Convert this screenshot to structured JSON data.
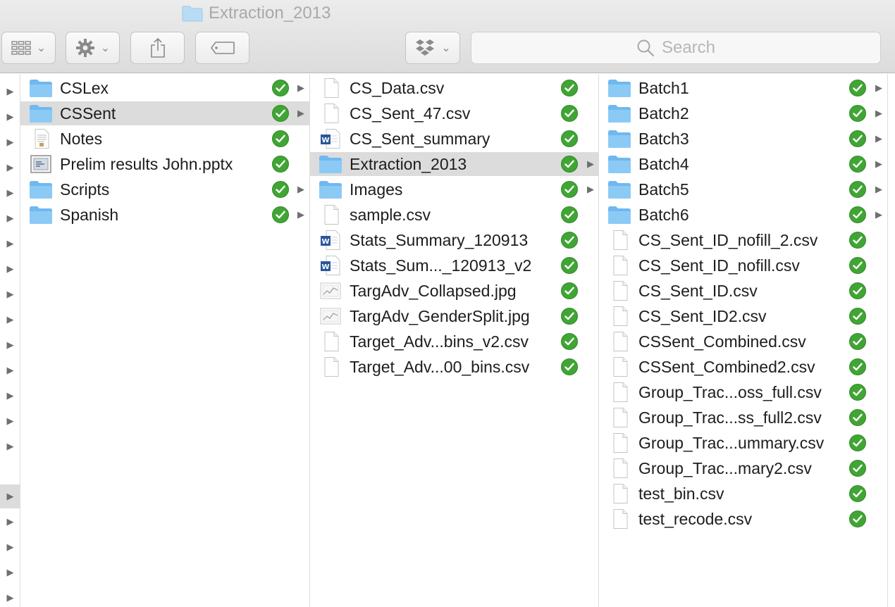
{
  "window": {
    "title": "Extraction_2013"
  },
  "toolbar": {
    "view_icon": "icon-grid-view",
    "action_icon": "gear-icon",
    "share_icon": "share-icon",
    "tag_icon": "tag-icon",
    "dropbox_icon": "dropbox-icon",
    "search_placeholder": "Search"
  },
  "colors": {
    "selection": "#dcdcdc",
    "folder": "#6fb8f0",
    "sync_check": "#41a535",
    "title_text": "#a9a9a9"
  },
  "column1": {
    "items": [
      {
        "name": "CSLex",
        "type": "folder",
        "expandable": true,
        "selected": false
      },
      {
        "name": "CSSent",
        "type": "folder",
        "expandable": true,
        "selected": true
      },
      {
        "name": "Notes",
        "type": "text-doc",
        "expandable": false,
        "selected": false
      },
      {
        "name": "Prelim results John.pptx",
        "type": "pptx",
        "expandable": false,
        "selected": false
      },
      {
        "name": "Scripts",
        "type": "folder",
        "expandable": true,
        "selected": false
      },
      {
        "name": "Spanish",
        "type": "folder",
        "expandable": true,
        "selected": false
      }
    ]
  },
  "column2": {
    "items": [
      {
        "name": "CS_Data.csv",
        "type": "file",
        "expandable": false,
        "selected": false
      },
      {
        "name": "CS_Sent_47.csv",
        "type": "file",
        "expandable": false,
        "selected": false
      },
      {
        "name": "CS_Sent_summary",
        "type": "word",
        "expandable": false,
        "selected": false
      },
      {
        "name": "Extraction_2013",
        "type": "folder",
        "expandable": true,
        "selected": true
      },
      {
        "name": "Images",
        "type": "folder",
        "expandable": true,
        "selected": false
      },
      {
        "name": "sample.csv",
        "type": "file",
        "expandable": false,
        "selected": false
      },
      {
        "name": "Stats_Summary_120913",
        "type": "word",
        "expandable": false,
        "selected": false
      },
      {
        "name": "Stats_Sum..._120913_v2",
        "type": "word",
        "expandable": false,
        "selected": false
      },
      {
        "name": "TargAdv_Collapsed.jpg",
        "type": "image",
        "expandable": false,
        "selected": false
      },
      {
        "name": "TargAdv_GenderSplit.jpg",
        "type": "image",
        "expandable": false,
        "selected": false
      },
      {
        "name": "Target_Adv...bins_v2.csv",
        "type": "file",
        "expandable": false,
        "selected": false
      },
      {
        "name": "Target_Adv...00_bins.csv",
        "type": "file",
        "expandable": false,
        "selected": false
      }
    ]
  },
  "column3": {
    "items": [
      {
        "name": "Batch1",
        "type": "folder",
        "expandable": true,
        "selected": false
      },
      {
        "name": "Batch2",
        "type": "folder",
        "expandable": true,
        "selected": false
      },
      {
        "name": "Batch3",
        "type": "folder",
        "expandable": true,
        "selected": false
      },
      {
        "name": "Batch4",
        "type": "folder",
        "expandable": true,
        "selected": false
      },
      {
        "name": "Batch5",
        "type": "folder",
        "expandable": true,
        "selected": false
      },
      {
        "name": "Batch6",
        "type": "folder",
        "expandable": true,
        "selected": false
      },
      {
        "name": "CS_Sent_ID_nofill_2.csv",
        "type": "file",
        "expandable": false,
        "selected": false
      },
      {
        "name": "CS_Sent_ID_nofill.csv",
        "type": "file",
        "expandable": false,
        "selected": false
      },
      {
        "name": "CS_Sent_ID.csv",
        "type": "file",
        "expandable": false,
        "selected": false
      },
      {
        "name": "CS_Sent_ID2.csv",
        "type": "file",
        "expandable": false,
        "selected": false
      },
      {
        "name": "CSSent_Combined.csv",
        "type": "file",
        "expandable": false,
        "selected": false
      },
      {
        "name": "CSSent_Combined2.csv",
        "type": "file",
        "expandable": false,
        "selected": false
      },
      {
        "name": "Group_Trac...oss_full.csv",
        "type": "file",
        "expandable": false,
        "selected": false
      },
      {
        "name": "Group_Trac...ss_full2.csv",
        "type": "file",
        "expandable": false,
        "selected": false
      },
      {
        "name": "Group_Trac...ummary.csv",
        "type": "file",
        "expandable": false,
        "selected": false
      },
      {
        "name": "Group_Trac...mary2.csv",
        "type": "file",
        "expandable": false,
        "selected": false
      },
      {
        "name": "test_bin.csv",
        "type": "file",
        "expandable": false,
        "selected": false
      },
      {
        "name": "test_recode.csv",
        "type": "file",
        "expandable": false,
        "selected": false
      }
    ]
  },
  "parent_column": {
    "arrow_count": 15,
    "selected_row_after_gap": 1
  }
}
